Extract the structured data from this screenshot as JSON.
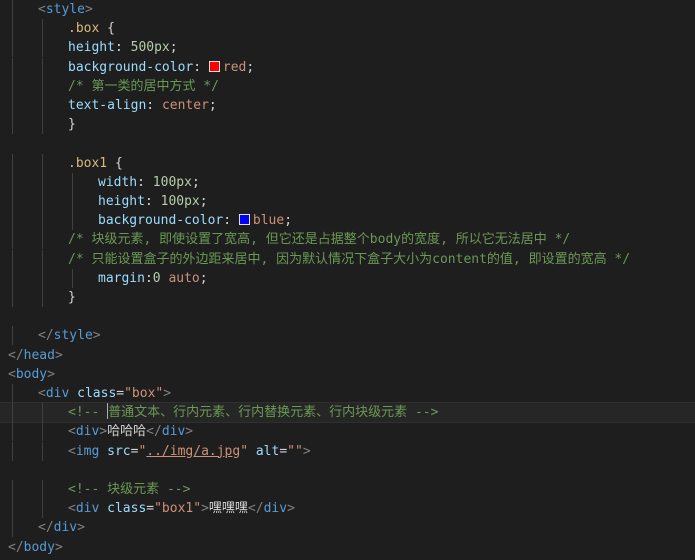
{
  "editor": {
    "lines": [
      {
        "indent": 4,
        "tokens": [
          [
            "tok-punct",
            "<"
          ],
          [
            "tok-tag",
            "style"
          ],
          [
            "tok-punct",
            ">"
          ]
        ]
      },
      {
        "indent": 8,
        "tokens": [
          [
            "tok-sel",
            ".box"
          ],
          [
            "tok-text",
            " {"
          ]
        ]
      },
      {
        "indent": 8,
        "tokens": [
          [
            "tok-prop",
            "height"
          ],
          [
            "tok-text",
            ": "
          ],
          [
            "tok-num",
            "500px"
          ],
          [
            "tok-text",
            ";"
          ]
        ]
      },
      {
        "indent": 8,
        "tokens": [
          [
            "tok-prop",
            "background-color"
          ],
          [
            "tok-text",
            ": "
          ],
          [
            "swatch",
            "#ff0000"
          ],
          [
            "tok-val",
            "red"
          ],
          [
            "tok-text",
            ";"
          ]
        ]
      },
      {
        "indent": 8,
        "tokens": [
          [
            "tok-com",
            "/* 第一类的居中方式 */"
          ]
        ]
      },
      {
        "indent": 8,
        "tokens": [
          [
            "tok-prop",
            "text-align"
          ],
          [
            "tok-text",
            ": "
          ],
          [
            "tok-val",
            "center"
          ],
          [
            "tok-text",
            ";"
          ]
        ]
      },
      {
        "indent": 8,
        "tokens": [
          [
            "tok-text",
            "}"
          ]
        ]
      },
      {
        "indent": 0,
        "tokens": []
      },
      {
        "indent": 8,
        "tokens": [
          [
            "tok-sel",
            ".box1"
          ],
          [
            "tok-text",
            " {"
          ]
        ]
      },
      {
        "indent": 12,
        "tokens": [
          [
            "tok-prop",
            "width"
          ],
          [
            "tok-text",
            ": "
          ],
          [
            "tok-num",
            "100px"
          ],
          [
            "tok-text",
            ";"
          ]
        ]
      },
      {
        "indent": 12,
        "tokens": [
          [
            "tok-prop",
            "height"
          ],
          [
            "tok-text",
            ": "
          ],
          [
            "tok-num",
            "100px"
          ],
          [
            "tok-text",
            ";"
          ]
        ]
      },
      {
        "indent": 12,
        "tokens": [
          [
            "tok-prop",
            "background-color"
          ],
          [
            "tok-text",
            ": "
          ],
          [
            "swatch",
            "#0000ff"
          ],
          [
            "tok-val",
            "blue"
          ],
          [
            "tok-text",
            ";"
          ]
        ]
      },
      {
        "indent": 8,
        "tokens": [
          [
            "tok-com",
            "/* 块级元素, 即使设置了宽高, 但它还是占据整个body的宽度, 所以它无法居中 */"
          ]
        ]
      },
      {
        "indent": 8,
        "tokens": [
          [
            "tok-com",
            "/* 只能设置盒子的外边距来居中, 因为默认情况下盒子大小为content的值, 即设置的宽高 */"
          ]
        ]
      },
      {
        "indent": 12,
        "tokens": [
          [
            "tok-prop",
            "margin"
          ],
          [
            "tok-text",
            ":"
          ],
          [
            "tok-num",
            "0"
          ],
          [
            "tok-text",
            " "
          ],
          [
            "tok-val",
            "auto"
          ],
          [
            "tok-text",
            ";"
          ]
        ]
      },
      {
        "indent": 8,
        "tokens": [
          [
            "tok-text",
            "}"
          ]
        ]
      },
      {
        "indent": 0,
        "tokens": []
      },
      {
        "indent": 4,
        "tokens": [
          [
            "tok-punct",
            "</"
          ],
          [
            "tok-tag",
            "style"
          ],
          [
            "tok-punct",
            ">"
          ]
        ]
      },
      {
        "indent": 0,
        "tokens": [
          [
            "tok-punct",
            "</"
          ],
          [
            "tok-tag",
            "head"
          ],
          [
            "tok-punct",
            ">"
          ]
        ]
      },
      {
        "indent": 0,
        "tokens": [
          [
            "tok-punct",
            "<"
          ],
          [
            "tok-tag",
            "body"
          ],
          [
            "tok-punct",
            ">"
          ]
        ]
      },
      {
        "indent": 4,
        "tokens": [
          [
            "tok-punct",
            "<"
          ],
          [
            "tok-tag",
            "div"
          ],
          [
            "tok-text",
            " "
          ],
          [
            "tok-attr",
            "class"
          ],
          [
            "tok-text",
            "="
          ],
          [
            "tok-str",
            "\"box\""
          ],
          [
            "tok-punct",
            ">"
          ]
        ]
      },
      {
        "indent": 8,
        "active": true,
        "tokens": [
          [
            "tok-com",
            "<!-- "
          ],
          [
            "caret",
            ""
          ],
          [
            "tok-com",
            "普通文本、行内元素、行内替换元素、行内块级元素 -->"
          ]
        ]
      },
      {
        "indent": 8,
        "tokens": [
          [
            "tok-punct",
            "<"
          ],
          [
            "tok-tag",
            "div"
          ],
          [
            "tok-punct",
            ">"
          ],
          [
            "tok-text",
            "哈哈哈"
          ],
          [
            "tok-punct",
            "</"
          ],
          [
            "tok-tag",
            "div"
          ],
          [
            "tok-punct",
            ">"
          ]
        ]
      },
      {
        "indent": 8,
        "tokens": [
          [
            "tok-punct",
            "<"
          ],
          [
            "tok-tag",
            "img"
          ],
          [
            "tok-text",
            " "
          ],
          [
            "tok-attr",
            "src"
          ],
          [
            "tok-text",
            "="
          ],
          [
            "tok-str",
            "\""
          ],
          [
            "tok-link",
            "../img/a.jpg"
          ],
          [
            "tok-str",
            "\""
          ],
          [
            "tok-text",
            " "
          ],
          [
            "tok-attr",
            "alt"
          ],
          [
            "tok-text",
            "="
          ],
          [
            "tok-str",
            "\"\""
          ],
          [
            "tok-punct",
            ">"
          ]
        ]
      },
      {
        "indent": 0,
        "tokens": []
      },
      {
        "indent": 8,
        "tokens": [
          [
            "tok-com",
            "<!-- 块级元素 -->"
          ]
        ]
      },
      {
        "indent": 8,
        "tokens": [
          [
            "tok-punct",
            "<"
          ],
          [
            "tok-tag",
            "div"
          ],
          [
            "tok-text",
            " "
          ],
          [
            "tok-attr",
            "class"
          ],
          [
            "tok-text",
            "="
          ],
          [
            "tok-str",
            "\"box1\""
          ],
          [
            "tok-punct",
            ">"
          ],
          [
            "tok-text",
            "嘿嘿嘿"
          ],
          [
            "tok-punct",
            "</"
          ],
          [
            "tok-tag",
            "div"
          ],
          [
            "tok-punct",
            ">"
          ]
        ]
      },
      {
        "indent": 4,
        "tokens": [
          [
            "tok-punct",
            "</"
          ],
          [
            "tok-tag",
            "div"
          ],
          [
            "tok-punct",
            ">"
          ]
        ]
      },
      {
        "indent": 0,
        "tokens": [
          [
            "tok-punct",
            "</"
          ],
          [
            "tok-tag",
            "body"
          ],
          [
            "tok-punct",
            ">"
          ]
        ]
      }
    ]
  }
}
